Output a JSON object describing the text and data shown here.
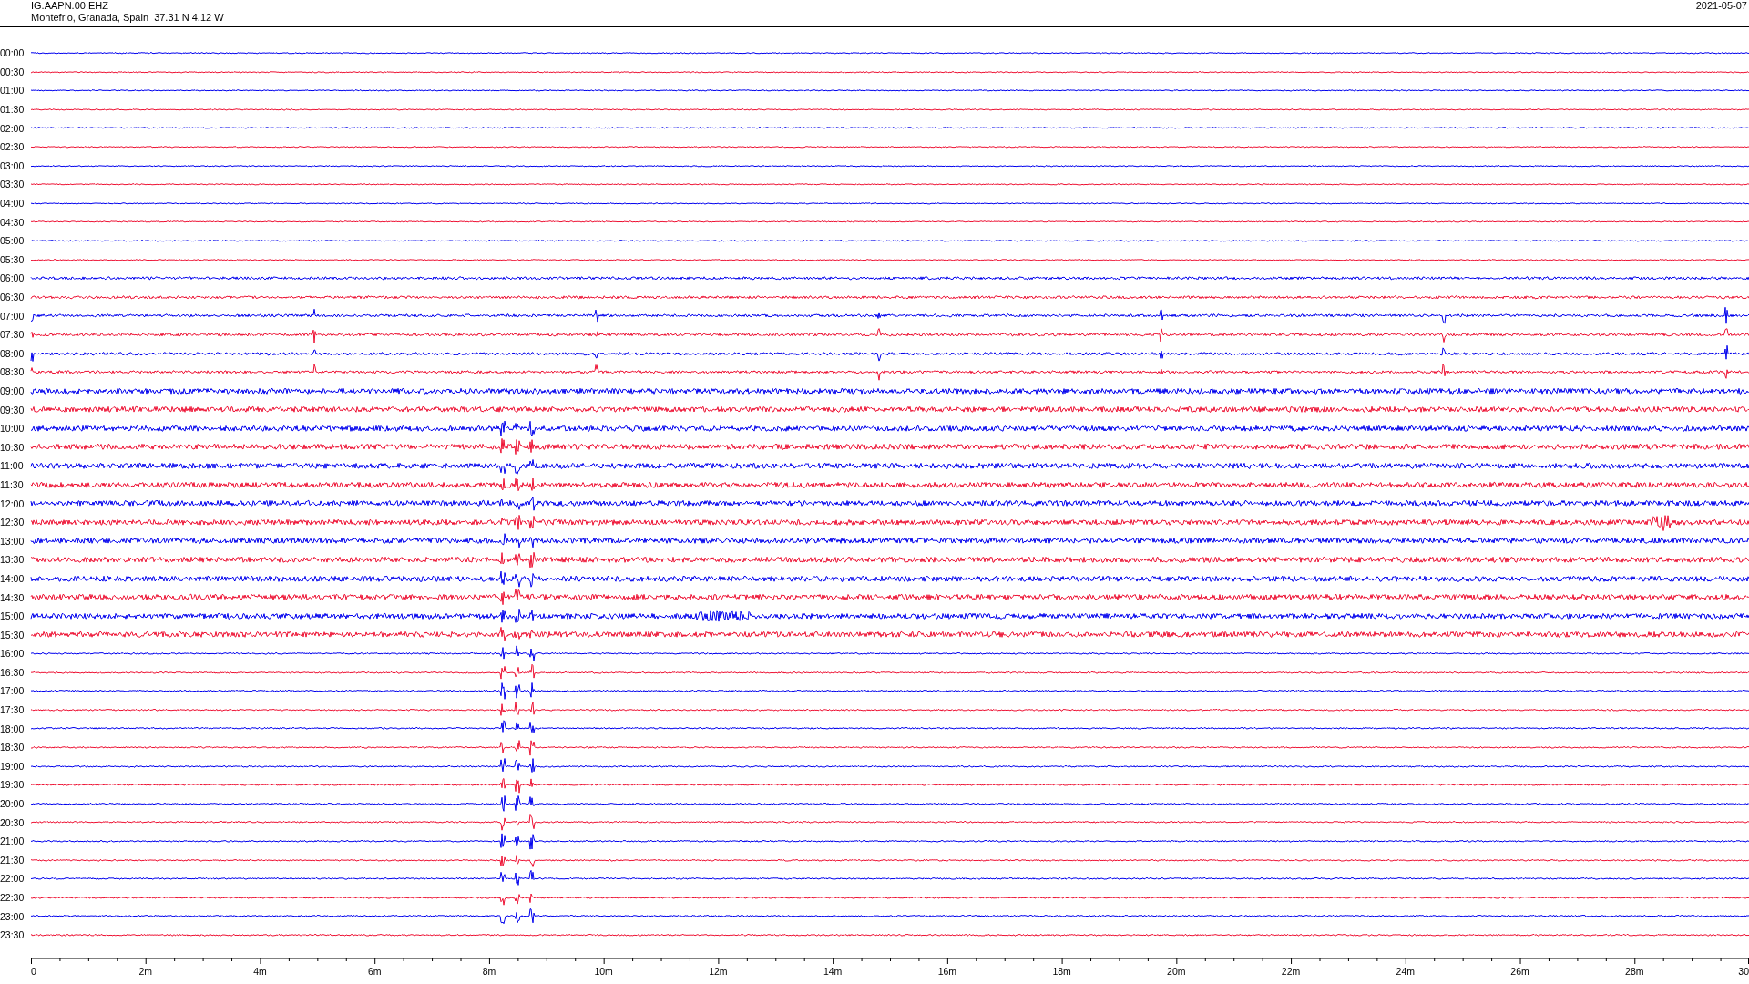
{
  "header": {
    "station": "IG.AAPN.00.EHZ",
    "location": "Montefrio, Granada, Spain  37.31 N 4.12 W",
    "date": "2021-05-07"
  },
  "rows": [
    {
      "time": "00:00",
      "color": "#0000ee"
    },
    {
      "time": "00:30",
      "color": "#ee1133"
    },
    {
      "time": "01:00",
      "color": "#0000ee"
    },
    {
      "time": "01:30",
      "color": "#ee1133"
    },
    {
      "time": "02:00",
      "color": "#0000ee"
    },
    {
      "time": "02:30",
      "color": "#ee1133"
    },
    {
      "time": "03:00",
      "color": "#0000ee"
    },
    {
      "time": "03:30",
      "color": "#ee1133"
    },
    {
      "time": "04:00",
      "color": "#0000ee"
    },
    {
      "time": "04:30",
      "color": "#ee1133"
    },
    {
      "time": "05:00",
      "color": "#0000ee"
    },
    {
      "time": "05:30",
      "color": "#ee1133"
    },
    {
      "time": "06:00",
      "color": "#0000ee"
    },
    {
      "time": "06:30",
      "color": "#ee1133"
    },
    {
      "time": "07:00",
      "color": "#0000ee"
    },
    {
      "time": "07:30",
      "color": "#ee1133"
    },
    {
      "time": "08:00",
      "color": "#0000ee"
    },
    {
      "time": "08:30",
      "color": "#ee1133"
    },
    {
      "time": "09:00",
      "color": "#0000ee"
    },
    {
      "time": "09:30",
      "color": "#ee1133"
    },
    {
      "time": "10:00",
      "color": "#0000ee"
    },
    {
      "time": "10:30",
      "color": "#ee1133"
    },
    {
      "time": "11:00",
      "color": "#0000ee"
    },
    {
      "time": "11:30",
      "color": "#ee1133"
    },
    {
      "time": "12:00",
      "color": "#0000ee"
    },
    {
      "time": "12:30",
      "color": "#ee1133"
    },
    {
      "time": "13:00",
      "color": "#0000ee"
    },
    {
      "time": "13:30",
      "color": "#ee1133"
    },
    {
      "time": "14:00",
      "color": "#0000ee"
    },
    {
      "time": "14:30",
      "color": "#ee1133"
    },
    {
      "time": "15:00",
      "color": "#0000ee"
    },
    {
      "time": "15:30",
      "color": "#ee1133"
    },
    {
      "time": "16:00",
      "color": "#0000ee"
    },
    {
      "time": "16:30",
      "color": "#ee1133"
    },
    {
      "time": "17:00",
      "color": "#0000ee"
    },
    {
      "time": "17:30",
      "color": "#ee1133"
    },
    {
      "time": "18:00",
      "color": "#0000ee"
    },
    {
      "time": "18:30",
      "color": "#ee1133"
    },
    {
      "time": "19:00",
      "color": "#0000ee"
    },
    {
      "time": "19:30",
      "color": "#ee1133"
    },
    {
      "time": "20:00",
      "color": "#0000ee"
    },
    {
      "time": "20:30",
      "color": "#ee1133"
    },
    {
      "time": "21:00",
      "color": "#0000ee"
    },
    {
      "time": "21:30",
      "color": "#ee1133"
    },
    {
      "time": "22:00",
      "color": "#0000ee"
    },
    {
      "time": "22:30",
      "color": "#ee1133"
    },
    {
      "time": "23:00",
      "color": "#0000ee"
    },
    {
      "time": "23:30",
      "color": "#ee1133"
    }
  ],
  "x_axis": {
    "ticks": [
      "0",
      "2m",
      "4m",
      "6m",
      "8m",
      "10m",
      "12m",
      "14m",
      "16m",
      "18m",
      "20m",
      "22m",
      "24m",
      "26m",
      "28m",
      "30"
    ]
  }
}
